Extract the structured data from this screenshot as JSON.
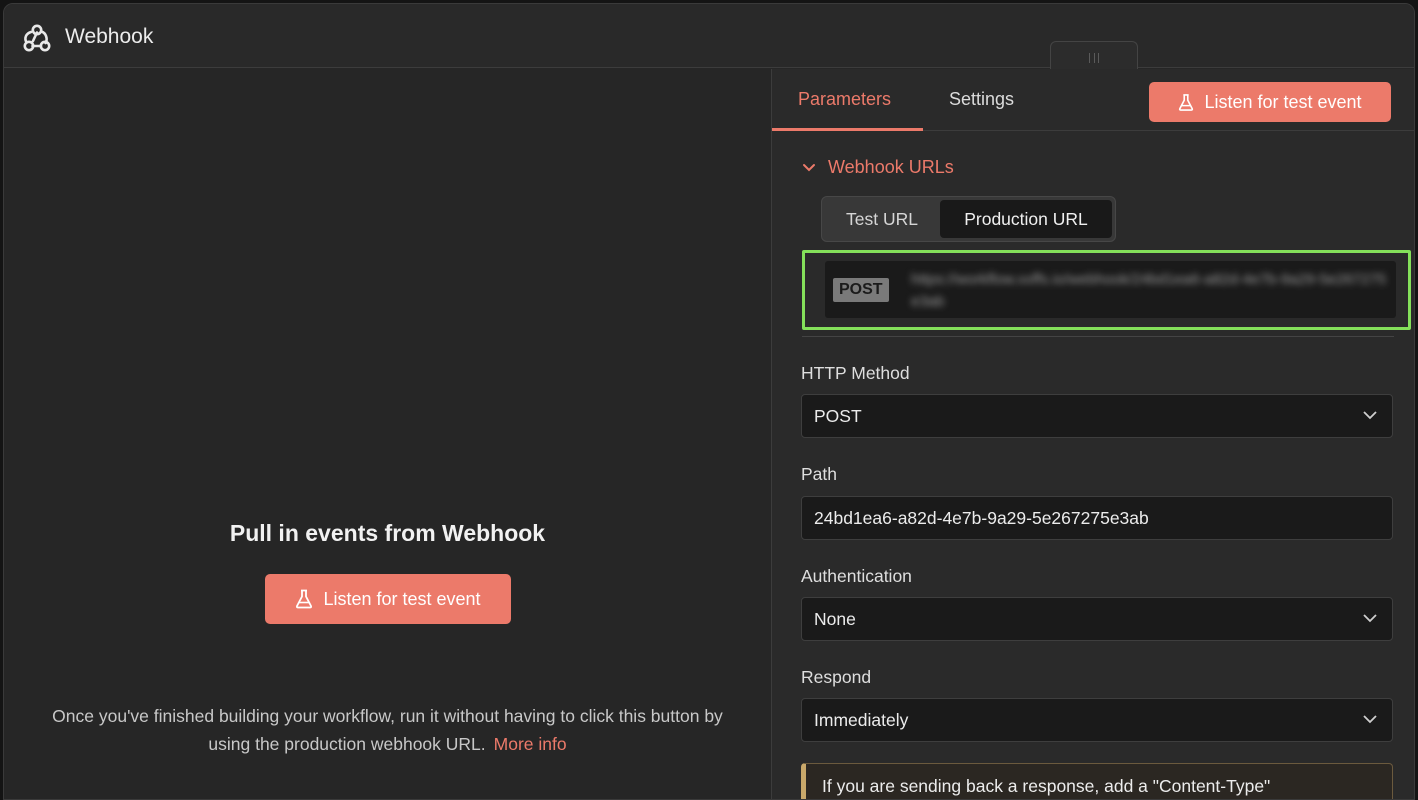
{
  "window": {
    "title": "Webhook"
  },
  "left": {
    "heading": "Pull in events from Webhook",
    "listen_button": "Listen for test event",
    "hint_text": "Once you've finished building your workflow, run it without having to click this button by using the production webhook URL.",
    "more_info": "More info"
  },
  "right": {
    "tabs": [
      {
        "label": "Parameters",
        "active": true
      },
      {
        "label": "Settings",
        "active": false
      }
    ],
    "listen_button": "Listen for test event",
    "section_title": "Webhook URLs",
    "url_toggle": {
      "test": "Test URL",
      "production": "Production URL",
      "selected": "Production URL"
    },
    "url_box": {
      "method": "POST",
      "url": "https://workflow.xxffs.io/webhook/24bd1ea6-a82d-4e7b-9a29-5e267275e3ab"
    },
    "fields": {
      "http_method": {
        "label": "HTTP Method",
        "value": "POST"
      },
      "path": {
        "label": "Path",
        "value": "24bd1ea6-a82d-4e7b-9a29-5e267275e3ab"
      },
      "authentication": {
        "label": "Authentication",
        "value": "None"
      },
      "respond": {
        "label": "Respond",
        "value": "Immediately"
      }
    },
    "notice": "If you are sending back a response, add a \"Content-Type\""
  },
  "colors": {
    "accent": "#ec7a6a",
    "highlight": "#84e05a",
    "background": "#262626"
  }
}
